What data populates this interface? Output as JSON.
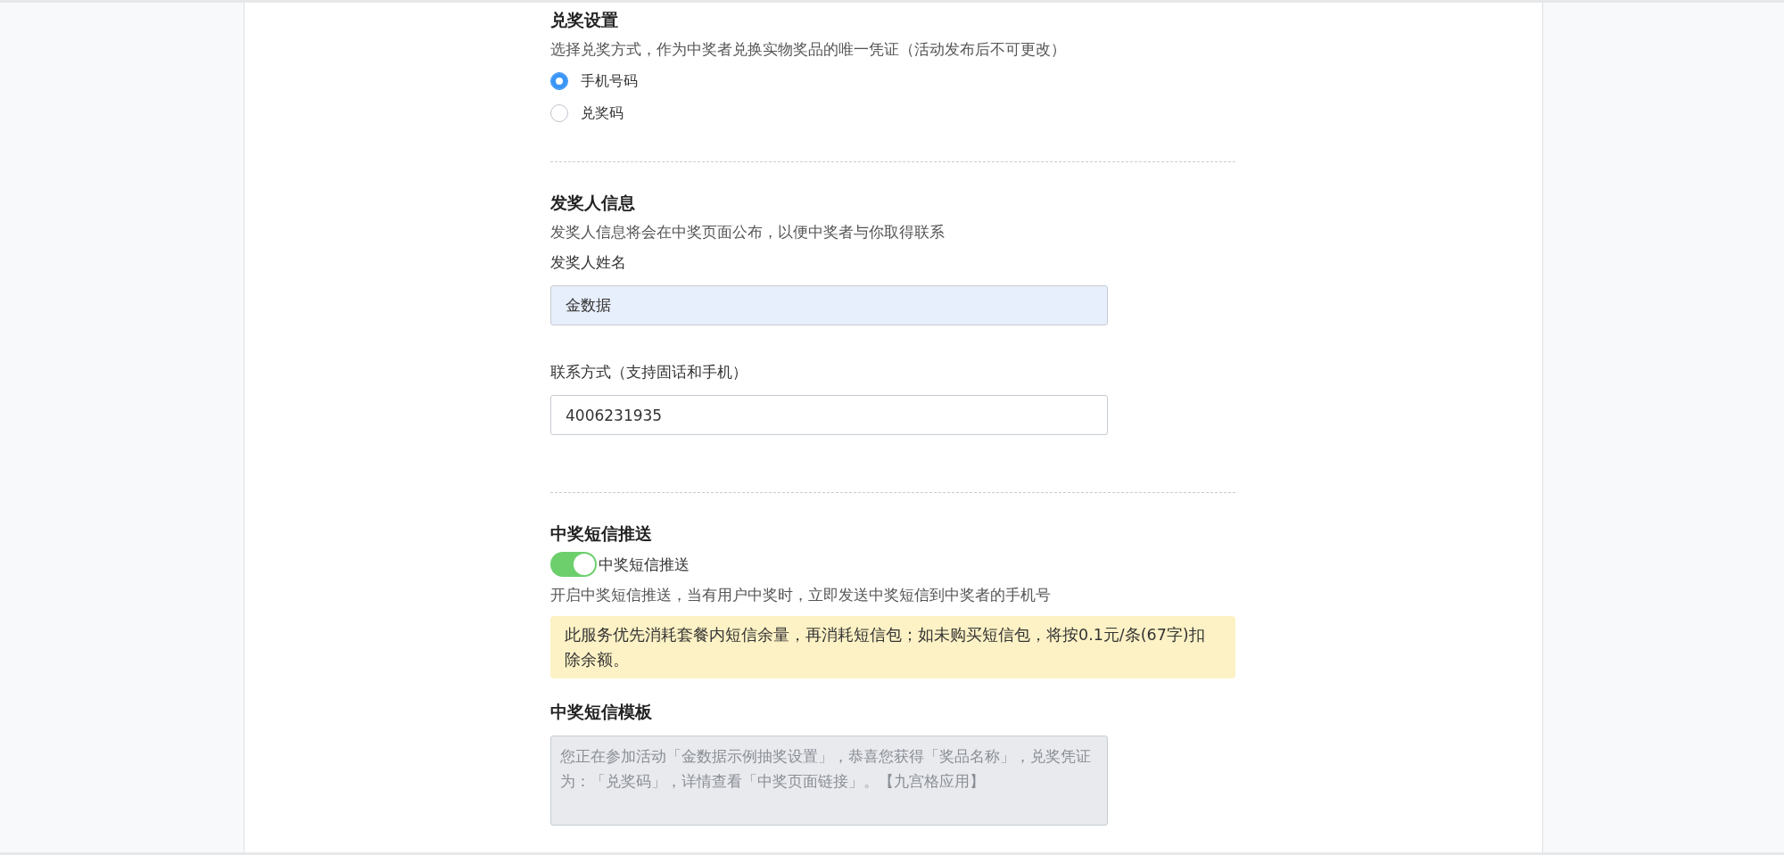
{
  "redeem_settings": {
    "title": "兑奖设置",
    "description": "选择兑奖方式，作为中奖者兑换实物奖品的唯一凭证（活动发布后不可更改）",
    "options": [
      {
        "label": "手机号码",
        "selected": true
      },
      {
        "label": "兑奖码",
        "selected": false
      }
    ]
  },
  "issuer_info": {
    "title": "发奖人信息",
    "description": "发奖人信息将会在中奖页面公布，以便中奖者与你取得联系",
    "fields": [
      {
        "label": "发奖人姓名",
        "value": "金数据",
        "autofilled": true
      },
      {
        "label": "联系方式（支持固话和手机）",
        "value": "4006231935",
        "autofilled": false
      }
    ]
  },
  "sms_push": {
    "title": "中奖短信推送",
    "toggle": {
      "label": "中奖短信推送",
      "on": true
    },
    "description": "开启中奖短信推送，当有用户中奖时，立即发送中奖短信到中奖者的手机号",
    "notice": "此服务优先消耗套餐内短信余量，再消耗短信包；如未购买短信包，将按0.1元/条(67字)扣除余额。"
  },
  "sms_template": {
    "title": "中奖短信模板",
    "value": "您正在参加活动「金数据示例抽奖设置」，恭喜您获得「奖品名称」，兑奖凭证为：「兑奖码」，详情查看「中奖页面链接」。【九宫格应用】",
    "disabled": true
  }
}
